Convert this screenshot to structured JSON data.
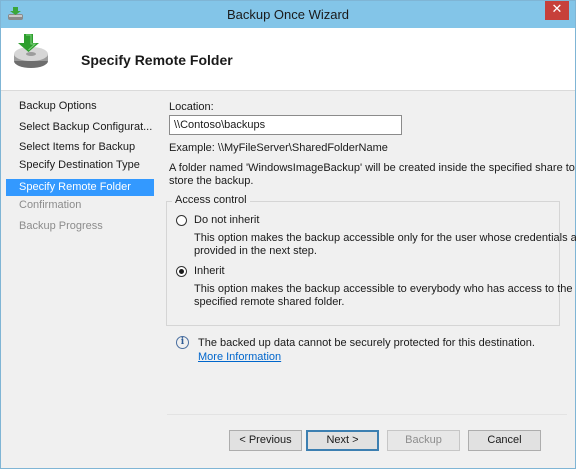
{
  "window": {
    "title": "Backup Once Wizard",
    "close_glyph": "✕"
  },
  "header": {
    "title": "Specify Remote Folder",
    "icon": "backup-disk-icon"
  },
  "sidebar": {
    "items": [
      {
        "label": "Backup Options",
        "state": "normal"
      },
      {
        "label": "Select Backup Configurat...",
        "state": "normal"
      },
      {
        "label": "Select Items for Backup",
        "state": "normal"
      },
      {
        "label": "Specify Destination Type",
        "state": "normal"
      },
      {
        "label": "Specify Remote Folder",
        "state": "selected"
      },
      {
        "label": "Confirmation",
        "state": "disabled"
      },
      {
        "label": "Backup Progress",
        "state": "disabled"
      }
    ]
  },
  "main": {
    "location_label": "Location:",
    "location_value": "\\\\Contoso\\backups",
    "example_text": "Example: \\\\MyFileServer\\SharedFolderName",
    "folder_note_line1": "A folder named 'WindowsImageBackup' will be created inside the specified share to",
    "folder_note_line2": "store the backup.",
    "access_control": {
      "legend": "Access control",
      "options": [
        {
          "label": "Do not inherit",
          "selected": false,
          "desc_line1": "This option makes the backup accessible only for the user whose credentials are",
          "desc_line2": "provided in the next step."
        },
        {
          "label": "Inherit",
          "selected": true,
          "desc_line1": "This option makes the backup accessible to everybody who has access to the",
          "desc_line2": "specified remote shared folder."
        }
      ]
    },
    "info_text": "The backed up data cannot be securely protected for this destination.",
    "info_link": "More Information"
  },
  "buttons": {
    "previous": "< Previous",
    "next": "Next >",
    "backup": "Backup",
    "cancel": "Cancel"
  },
  "colors": {
    "titlebar": "#83c5e8",
    "selected_nav": "#3399ff",
    "close_button": "#c7403a",
    "link": "#0066cc"
  }
}
